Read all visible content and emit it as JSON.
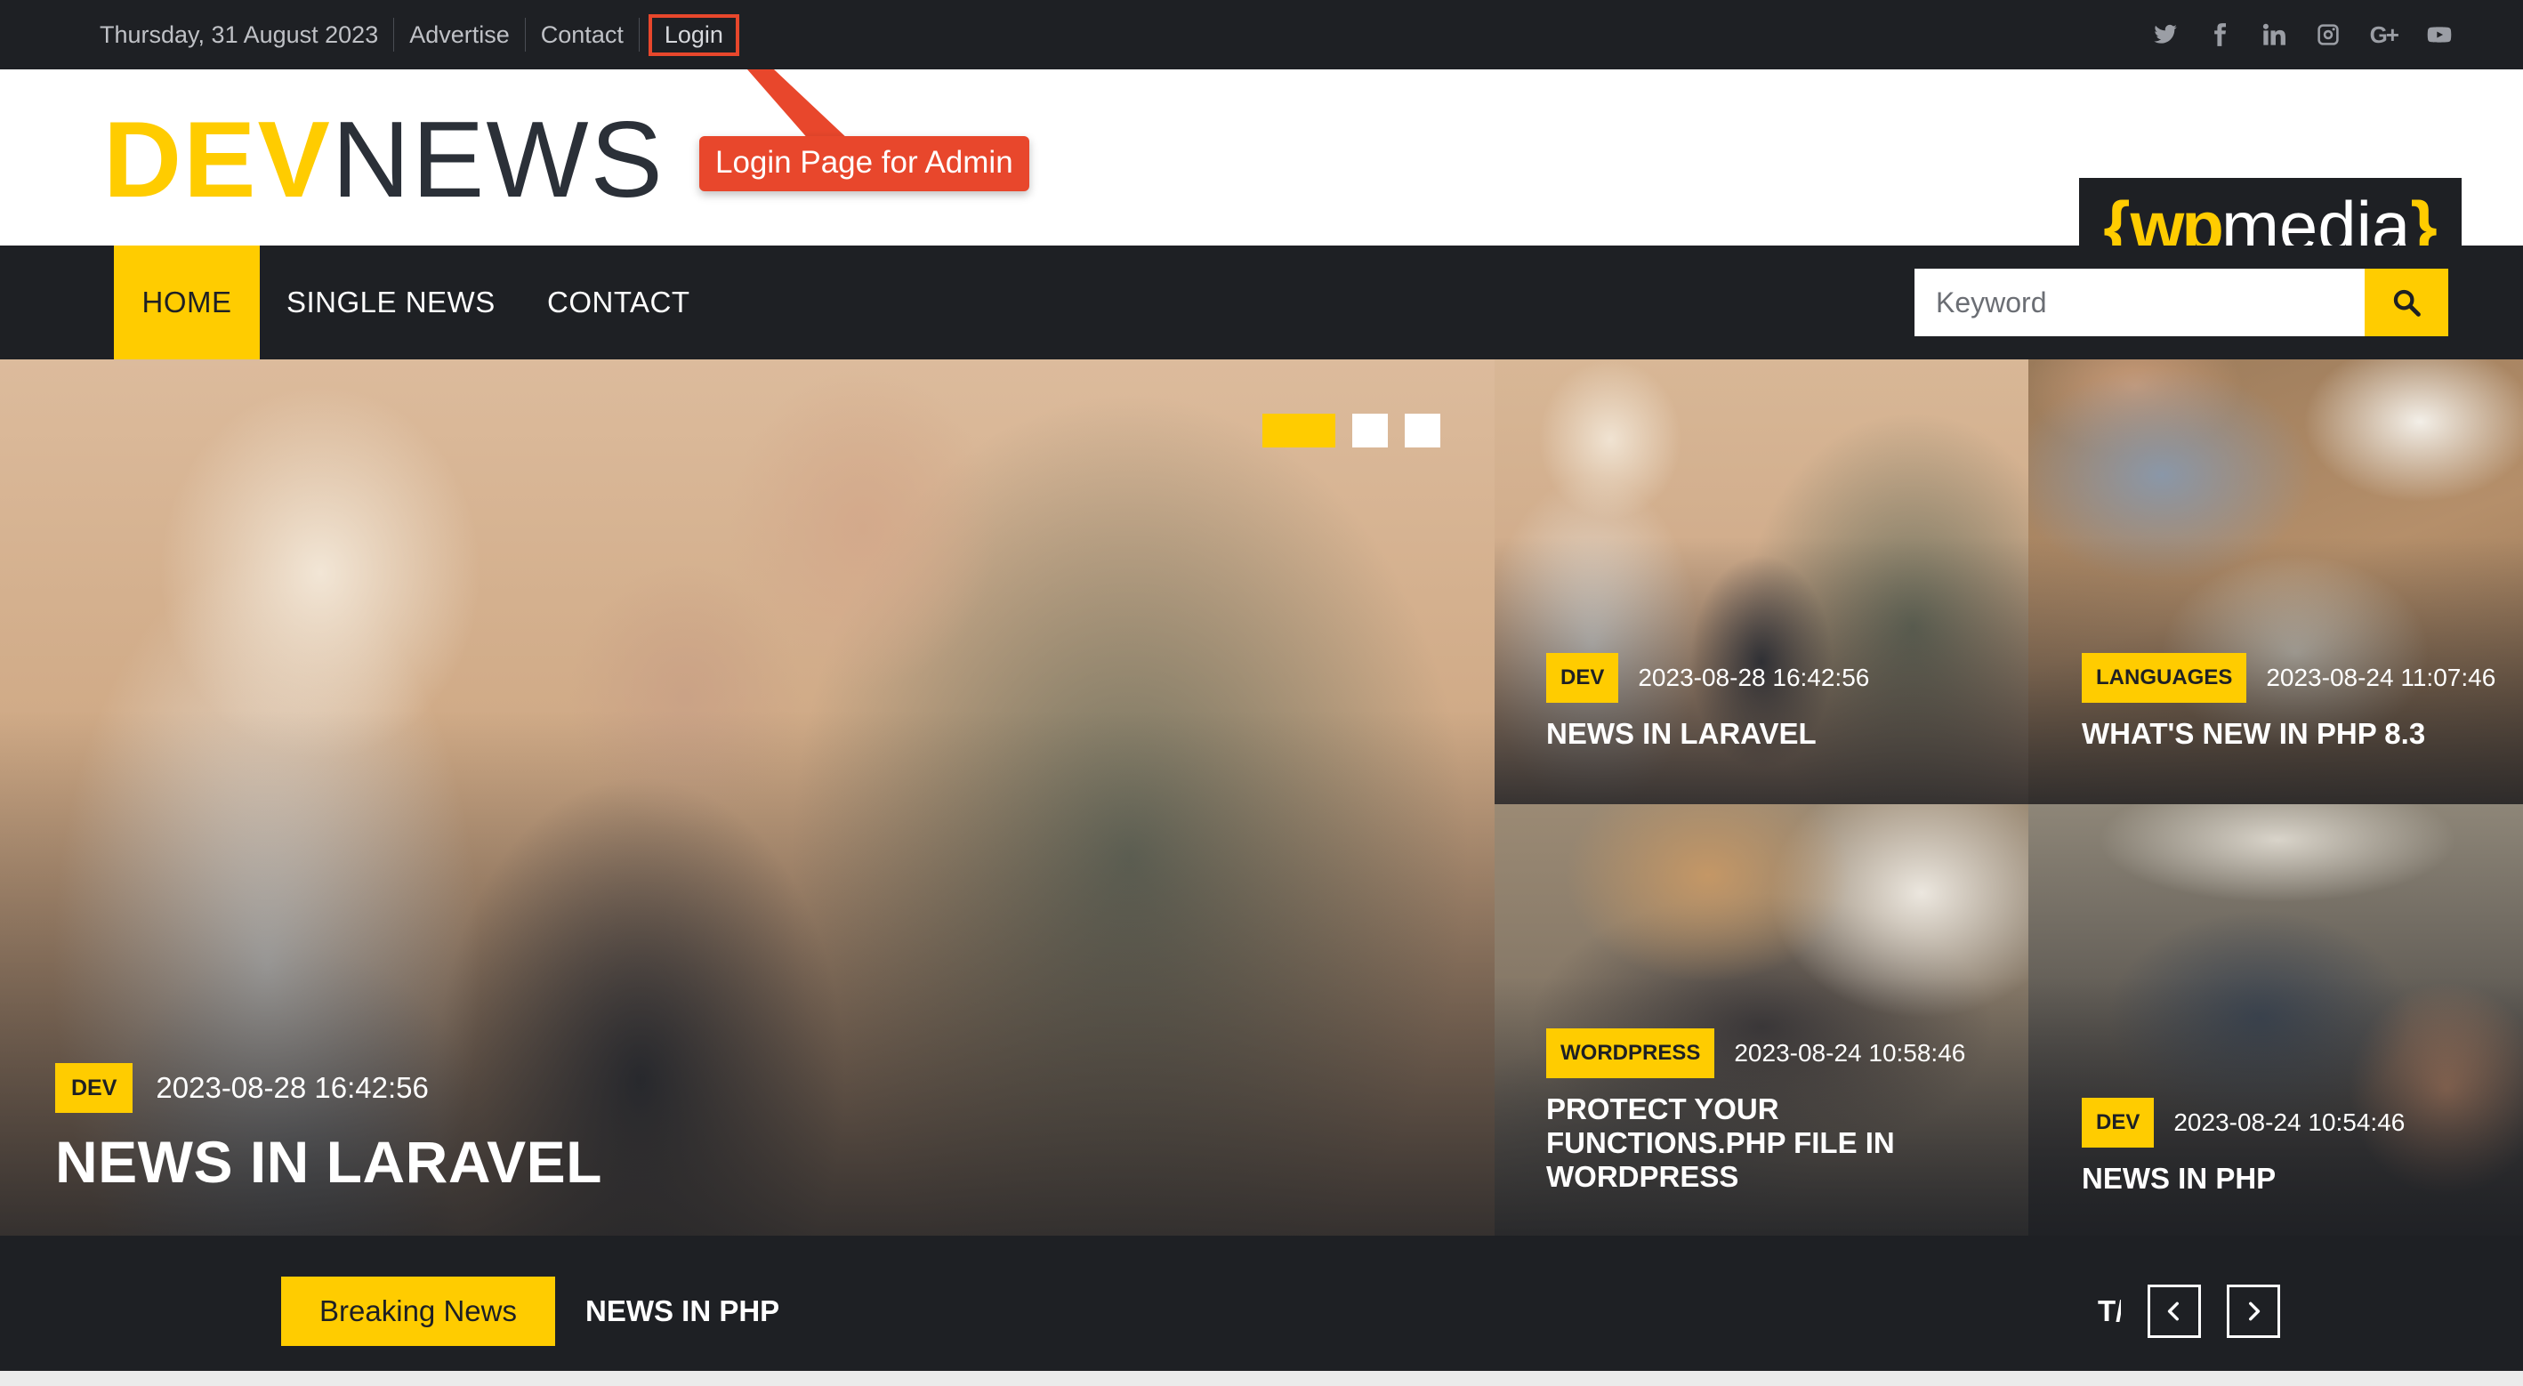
{
  "topbar": {
    "date": "Thursday, 31 August 2023",
    "links": [
      "Advertise",
      "Contact",
      "Login"
    ],
    "social_icons": [
      "twitter-icon",
      "facebook-icon",
      "linkedin-icon",
      "instagram-icon",
      "google-plus-icon",
      "youtube-icon"
    ],
    "google_plus_text": "G+"
  },
  "header": {
    "logo_dev": "DEV",
    "logo_news": "NEWS",
    "callout": "Login Page for Admin",
    "ad": {
      "open": "{",
      "wp": "wp",
      "media": "media",
      "close": "}"
    }
  },
  "nav": {
    "items": [
      "HOME",
      "SINGLE NEWS",
      "CONTACT"
    ],
    "active": "HOME",
    "search_placeholder": "Keyword"
  },
  "hero": {
    "main": {
      "category": "DEV",
      "date": "2023-08-28 16:42:56",
      "title": "NEWS IN LARAVEL"
    },
    "slider_dots": 3,
    "tiles": [
      {
        "category": "DEV",
        "date": "2023-08-28 16:42:56",
        "title": "NEWS IN LARAVEL"
      },
      {
        "category": "LANGUAGES",
        "date": "2023-08-24 11:07:46",
        "title": "WHAT'S NEW IN PHP 8.3"
      },
      {
        "category": "WORDPRESS",
        "date": "2023-08-24 10:58:46",
        "title": "PROTECT YOUR FUNCTIONS.PHP FILE IN WORDPRESS"
      },
      {
        "category": "DEV",
        "date": "2023-08-24 10:54:46",
        "title": "NEWS IN PHP"
      }
    ]
  },
  "breaking": {
    "label": "Breaking News",
    "current": "NEWS IN PHP",
    "next_partial": "T/"
  },
  "colors": {
    "accent": "#ffcc00",
    "dark": "#1e2024",
    "callout": "#e8472c"
  }
}
